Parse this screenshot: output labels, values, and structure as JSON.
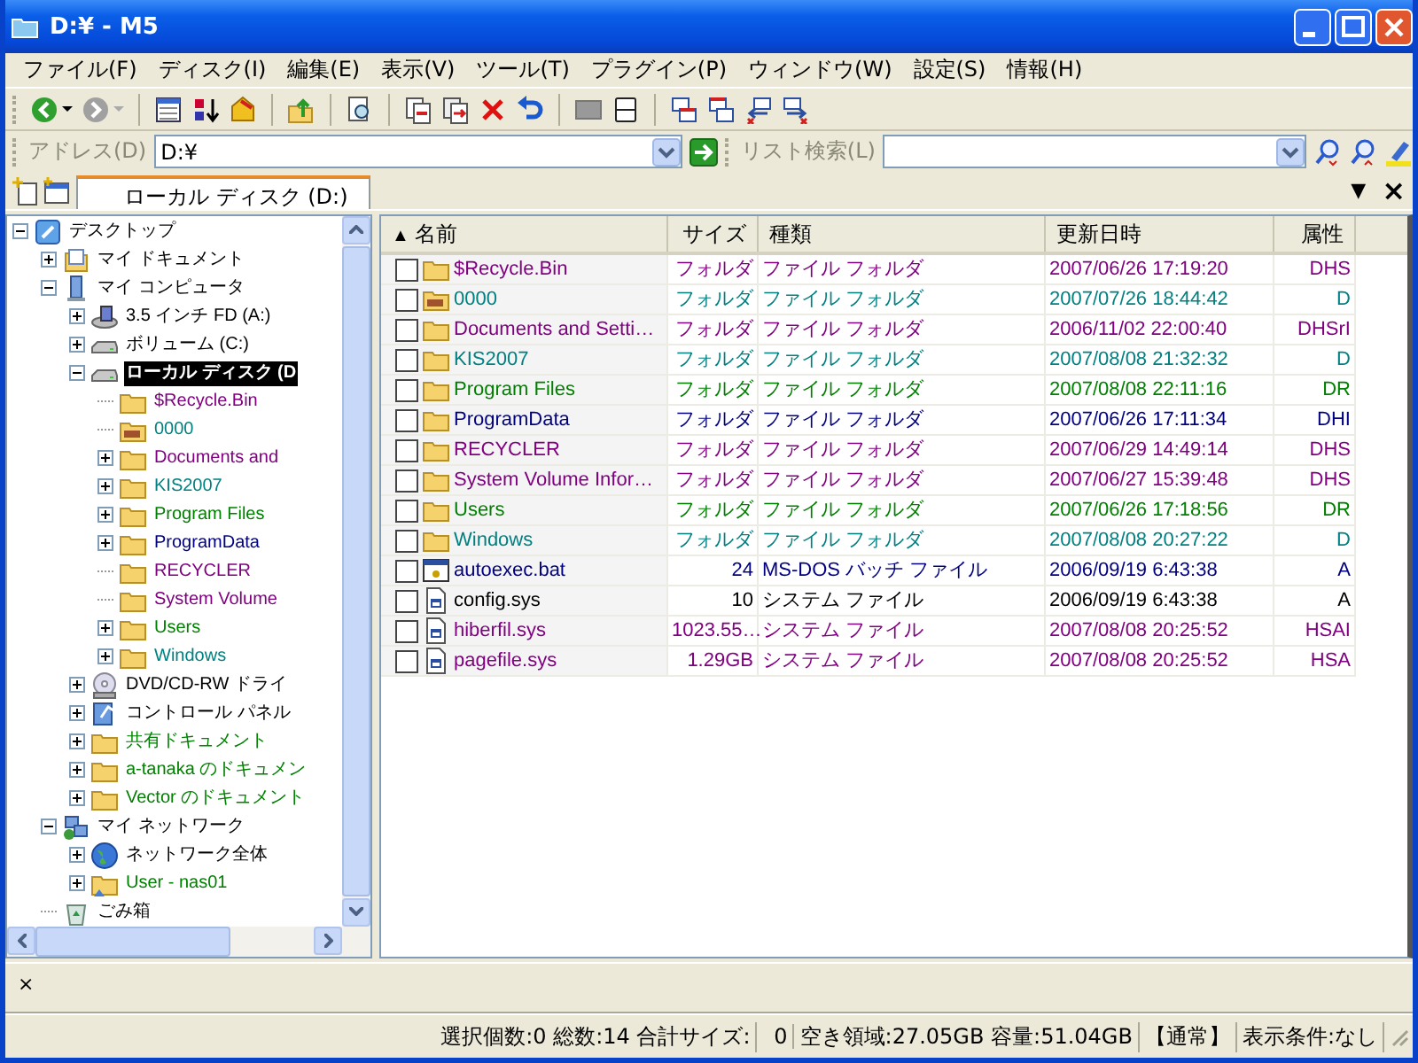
{
  "window": {
    "title": "D:¥ - M5"
  },
  "menu": [
    "ファイル(F)",
    "ディスク(I)",
    "編集(E)",
    "表示(V)",
    "ツール(T)",
    "プラグイン(P)",
    "ウィンドウ(W)",
    "設定(S)",
    "情報(H)"
  ],
  "address_bar": {
    "label": "アドレス(D)",
    "value": "D:¥"
  },
  "list_search": {
    "label": "リスト検索(L)"
  },
  "tabs": [
    {
      "label": "ローカル ディスク (D:)",
      "selected": true
    }
  ],
  "tab_menu": "▼",
  "tab_close": "×",
  "tree": [
    {
      "label": "デスクトップ",
      "kind": "desktop",
      "expanded": true,
      "selected": false,
      "color": "#000000",
      "children": [
        {
          "label": "マイ ドキュメント",
          "kind": "documents",
          "expanded": false,
          "selected": false,
          "color": "#000000"
        },
        {
          "label": "マイ コンピュータ",
          "kind": "computer",
          "expanded": true,
          "selected": false,
          "color": "#000000",
          "children": [
            {
              "label": "3.5 インチ FD (A:)",
              "kind": "floppy",
              "expanded": false,
              "selected": false,
              "color": "#000000"
            },
            {
              "label": "ボリューム (C:)",
              "kind": "drive",
              "expanded": false,
              "selected": false,
              "color": "#000000"
            },
            {
              "label": "ローカル ディスク (D",
              "kind": "drive",
              "expanded": true,
              "selected": true,
              "color": "#000000",
              "children": [
                {
                  "label": "$Recycle.Bin",
                  "kind": "folder",
                  "selected": false,
                  "color": "#800080"
                },
                {
                  "label": "0000",
                  "kind": "folder-image",
                  "selected": false,
                  "color": "#008080"
                },
                {
                  "label": "Documents and",
                  "kind": "folder",
                  "expanded": false,
                  "selected": false,
                  "color": "#800080"
                },
                {
                  "label": "KIS2007",
                  "kind": "folder",
                  "expanded": false,
                  "selected": false,
                  "color": "#008080"
                },
                {
                  "label": "Program Files",
                  "kind": "folder",
                  "expanded": false,
                  "selected": false,
                  "color": "#008000"
                },
                {
                  "label": "ProgramData",
                  "kind": "folder",
                  "expanded": false,
                  "selected": false,
                  "color": "#000080"
                },
                {
                  "label": "RECYCLER",
                  "kind": "folder",
                  "selected": false,
                  "color": "#800080"
                },
                {
                  "label": "System Volume",
                  "kind": "folder",
                  "selected": false,
                  "color": "#800080"
                },
                {
                  "label": "Users",
                  "kind": "folder",
                  "expanded": false,
                  "selected": false,
                  "color": "#008000"
                },
                {
                  "label": "Windows",
                  "kind": "folder",
                  "expanded": false,
                  "selected": false,
                  "color": "#008080"
                }
              ]
            },
            {
              "label": "DVD/CD-RW ドライ",
              "kind": "dvd",
              "expanded": false,
              "selected": false,
              "color": "#000000"
            },
            {
              "label": "コントロール パネル",
              "kind": "control-panel",
              "expanded": false,
              "selected": false,
              "color": "#000000"
            },
            {
              "label": "共有ドキュメント",
              "kind": "folder",
              "expanded": false,
              "selected": false,
              "color": "#008000"
            },
            {
              "label": "a-tanaka のドキュメン",
              "kind": "folder",
              "expanded": false,
              "selected": false,
              "color": "#008000"
            },
            {
              "label": "Vector のドキュメント",
              "kind": "folder",
              "expanded": false,
              "selected": false,
              "color": "#008000"
            }
          ]
        },
        {
          "label": "マイ ネットワーク",
          "kind": "network",
          "expanded": true,
          "selected": false,
          "color": "#000000",
          "children": [
            {
              "label": "ネットワーク全体",
              "kind": "globe",
              "expanded": false,
              "selected": false,
              "color": "#000000"
            },
            {
              "label": "User - nas01",
              "kind": "shared-folder",
              "expanded": false,
              "selected": false,
              "color": "#008000"
            }
          ]
        },
        {
          "label": "ごみ箱",
          "kind": "recycle-bin",
          "selected": false,
          "color": "#000000"
        }
      ]
    }
  ],
  "table": {
    "sort_indicator": "▲",
    "columns": [
      "名前",
      "サイズ",
      "種類",
      "更新日時",
      "属性"
    ],
    "rows": [
      {
        "kind": "folder",
        "checked": false,
        "color": "#800080",
        "name": "$Recycle.Bin",
        "size": "フォルダ",
        "type": "ファイル フォルダ",
        "modified": "2007/06/26 17:19:20",
        "attributes": "DHS"
      },
      {
        "kind": "folder-image",
        "checked": false,
        "color": "#008080",
        "name": "0000",
        "size": "フォルダ",
        "type": "ファイル フォルダ",
        "modified": "2007/07/26 18:44:42",
        "attributes": "D"
      },
      {
        "kind": "folder",
        "checked": false,
        "color": "#800080",
        "name": "Documents and Setti…",
        "size": "フォルダ",
        "type": "ファイル フォルダ",
        "modified": "2006/11/02 22:00:40",
        "attributes": "DHSrI"
      },
      {
        "kind": "folder",
        "checked": false,
        "color": "#008080",
        "name": "KIS2007",
        "size": "フォルダ",
        "type": "ファイル フォルダ",
        "modified": "2007/08/08 21:32:32",
        "attributes": "D"
      },
      {
        "kind": "folder",
        "checked": false,
        "color": "#008000",
        "name": "Program Files",
        "size": "フォルダ",
        "type": "ファイル フォルダ",
        "modified": "2007/08/08 22:11:16",
        "attributes": "DR"
      },
      {
        "kind": "folder",
        "checked": false,
        "color": "#000080",
        "name": "ProgramData",
        "size": "フォルダ",
        "type": "ファイル フォルダ",
        "modified": "2007/06/26 17:11:34",
        "attributes": "DHI"
      },
      {
        "kind": "folder",
        "checked": false,
        "color": "#800080",
        "name": "RECYCLER",
        "size": "フォルダ",
        "type": "ファイル フォルダ",
        "modified": "2007/06/29 14:49:14",
        "attributes": "DHS"
      },
      {
        "kind": "folder",
        "checked": false,
        "color": "#800080",
        "name": "System Volume Infor…",
        "size": "フォルダ",
        "type": "ファイル フォルダ",
        "modified": "2007/06/27 15:39:48",
        "attributes": "DHS"
      },
      {
        "kind": "folder",
        "checked": false,
        "color": "#008000",
        "name": "Users",
        "size": "フォルダ",
        "type": "ファイル フォルダ",
        "modified": "2007/06/26 17:18:56",
        "attributes": "DR"
      },
      {
        "kind": "folder",
        "checked": false,
        "color": "#008080",
        "name": "Windows",
        "size": "フォルダ",
        "type": "ファイル フォルダ",
        "modified": "2007/08/08 20:27:22",
        "attributes": "D"
      },
      {
        "kind": "batch",
        "checked": false,
        "color": "#000080",
        "name": "autoexec.bat",
        "size": "24",
        "type": "MS-DOS バッチ ファイル",
        "modified": "2006/09/19 6:43:38",
        "attributes": "A"
      },
      {
        "kind": "system",
        "checked": false,
        "color": "#000000",
        "name": "config.sys",
        "size": "10",
        "type": "システム ファイル",
        "modified": "2006/09/19 6:43:38",
        "attributes": "A"
      },
      {
        "kind": "system",
        "checked": false,
        "color": "#800080",
        "name": "hiberfil.sys",
        "size": "1023.55…",
        "type": "システム ファイル",
        "modified": "2007/08/08 20:25:52",
        "attributes": "HSAI"
      },
      {
        "kind": "system",
        "checked": false,
        "color": "#800080",
        "name": "pagefile.sys",
        "size": "1.29GB",
        "type": "システム ファイル",
        "modified": "2007/08/08 20:25:52",
        "attributes": "HSA"
      }
    ]
  },
  "bottom_panel": {
    "close": "×"
  },
  "status_bar": [
    "選択個数:0 総数:14 合計サイズ:",
    "0",
    "空き領域:27.05GB 容量:51.04GB",
    "【通常】",
    "表示条件:なし"
  ]
}
